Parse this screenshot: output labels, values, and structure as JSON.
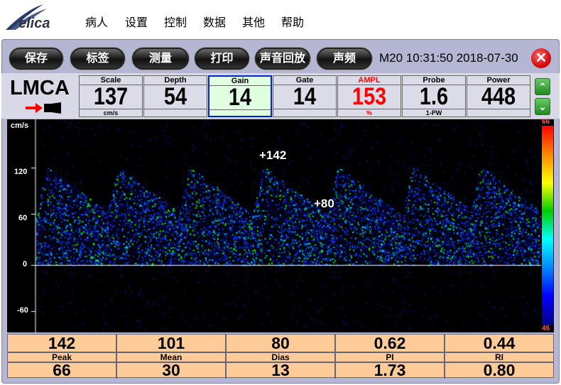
{
  "app": {
    "logo": "elica",
    "menu": [
      "病人",
      "设置",
      "控制",
      "数据",
      "其他",
      "帮助"
    ]
  },
  "toolbar": {
    "buttons": [
      "保存",
      "标签",
      "测量",
      "打印",
      "声音回放",
      "声频"
    ],
    "datetime": "M20 10:31:50 2018-07-30",
    "close_icon": "close-icon"
  },
  "vessel": {
    "name": "LMCA"
  },
  "params": [
    {
      "label": "Scale",
      "value": "137",
      "unit": "cm/s"
    },
    {
      "label": "Depth",
      "value": "54",
      "unit": ""
    },
    {
      "label": "Gain",
      "value": "14",
      "unit": "",
      "selected": true
    },
    {
      "label": "Gate",
      "value": "14",
      "unit": ""
    },
    {
      "label": "AMPL",
      "value": "153",
      "unit": "%",
      "color": "#ff0000"
    },
    {
      "label": "Probe",
      "value": "1.6",
      "unit": "1-PW"
    },
    {
      "label": "Power",
      "value": "448",
      "unit": ""
    }
  ],
  "spectrum": {
    "unit": "cm/s",
    "yticks": [
      "120",
      "60",
      "0",
      "-60"
    ],
    "annotations": [
      "+142",
      "+80"
    ],
    "colorbar": {
      "max": "66",
      "min": "46"
    }
  },
  "measurements": {
    "row1": [
      "142",
      "101",
      "80",
      "0.62",
      "0.44"
    ],
    "labels": [
      "Peak",
      "Mean",
      "Dias",
      "PI",
      "RI"
    ],
    "row2": [
      "66",
      "30",
      "13",
      "1.73",
      "0.80"
    ]
  }
}
